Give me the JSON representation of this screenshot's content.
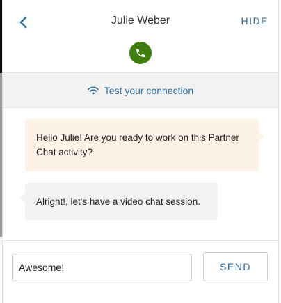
{
  "header": {
    "back_icon": "chevron-left-icon",
    "title": "Julie Weber",
    "hide_label": "HIDE",
    "call_icon": "phone-icon"
  },
  "connection": {
    "icon": "wifi-icon",
    "label": "Test your connection"
  },
  "messages": [
    {
      "text": "Hello Julie! Are you ready to work on this Partner Chat activity?"
    },
    {
      "text": "Alright!, let's have a video chat session."
    }
  ],
  "composer": {
    "input_value": "Awesome!",
    "send_label": "SEND"
  },
  "colors": {
    "accent": "#2f6f9f",
    "call_green": "#3e7d0e",
    "incoming_bubble": "#fdf2e6",
    "outgoing_bubble": "#f2f2f2"
  }
}
